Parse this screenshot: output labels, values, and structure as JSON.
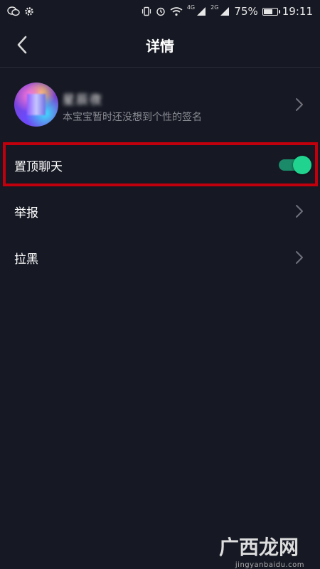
{
  "status_bar": {
    "left_icons": [
      "wechat-icon",
      "gear-icon"
    ],
    "right": {
      "icons": [
        "vibrate-icon",
        "alarm-icon",
        "wifi-icon"
      ],
      "signal1": "4G",
      "signal2": "2G",
      "battery": "75%",
      "battery_level": 0.75,
      "time": "19:11"
    }
  },
  "nav": {
    "title": "详情",
    "back_icon": "chevron-left-icon"
  },
  "profile": {
    "name": "星辰夜",
    "signature": "本宝宝暂时还没想到个性的签名",
    "chevron": "chevron-right-icon"
  },
  "settings": {
    "pin_chat": {
      "label": "置顶聊天",
      "enabled": true
    },
    "report": {
      "label": "举报"
    },
    "block": {
      "label": "拉黑"
    }
  },
  "watermark": {
    "brand": "广西龙网",
    "url": "jingyanbaidu.com"
  },
  "colors": {
    "background": "#161823",
    "toggle_on": "#20d38e",
    "highlight": "#c0000c"
  }
}
